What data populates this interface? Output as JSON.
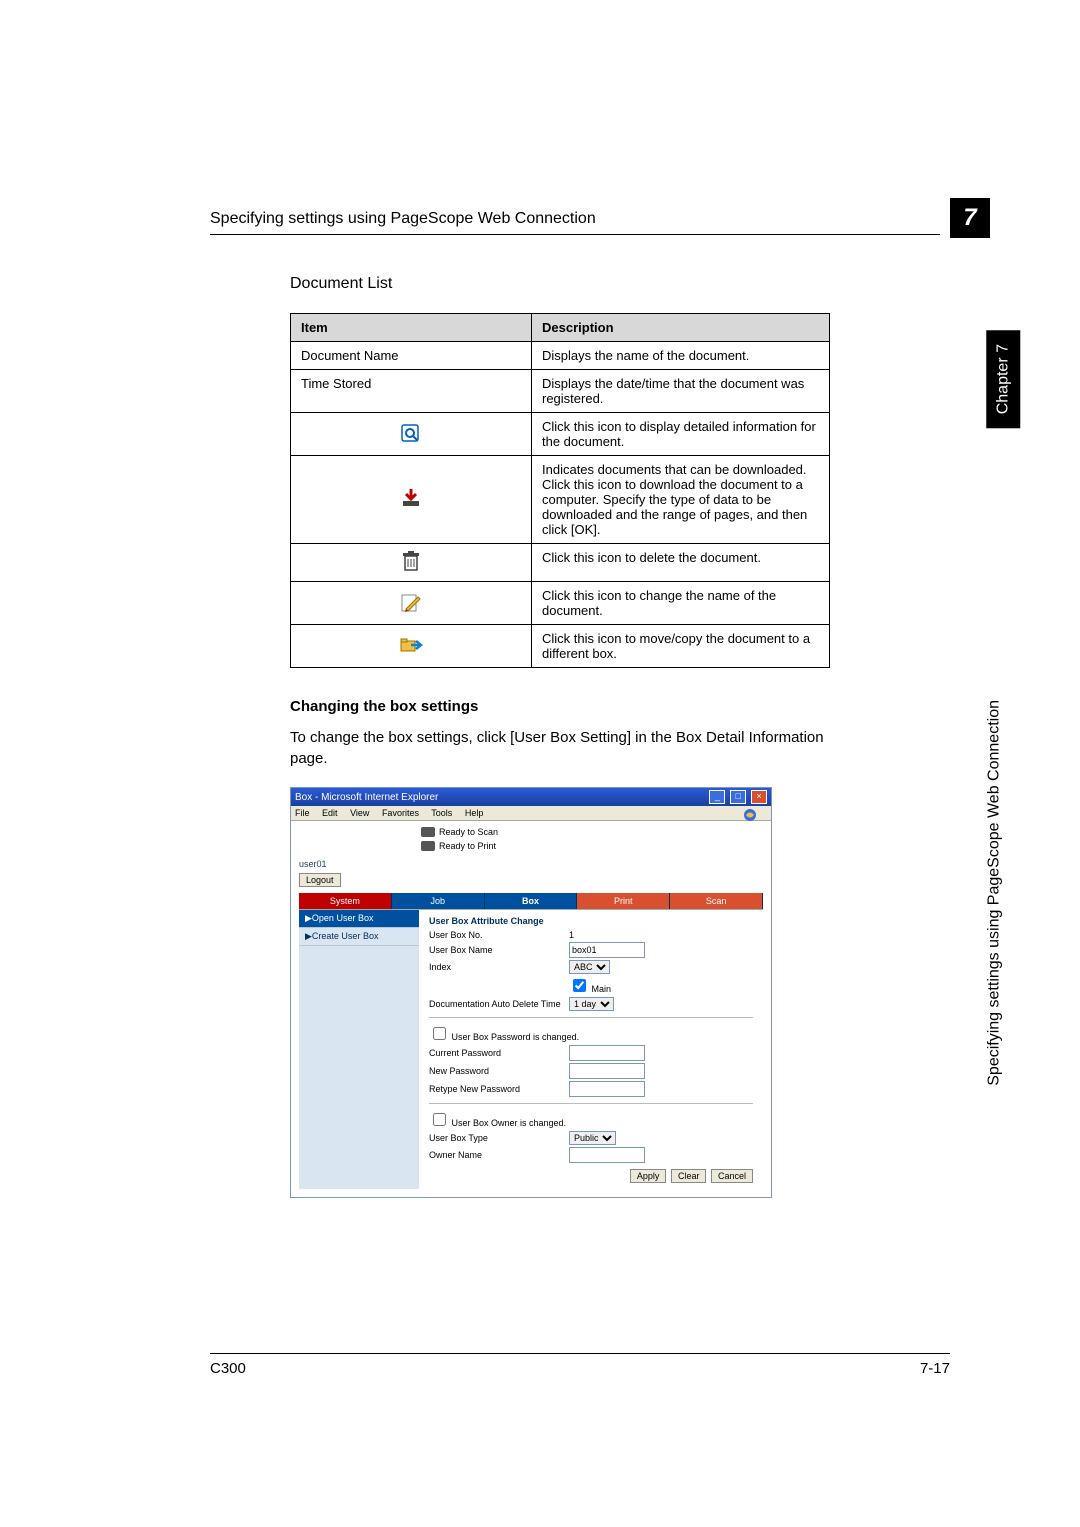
{
  "header": {
    "title": "Specifying settings using PageScope Web Connection"
  },
  "chapter": {
    "number": "7",
    "side_label": "Chapter 7",
    "side_text": "Specifying settings using PageScope Web Connection"
  },
  "section_title": "Document List",
  "table": {
    "headers": [
      "Item",
      "Description"
    ],
    "rows": [
      {
        "item_text": "Document Name",
        "desc": "Displays the name of the document."
      },
      {
        "item_text": "Time Stored",
        "desc": "Displays the date/time that the document was registered."
      },
      {
        "item_icon": "view-icon",
        "desc": "Click this icon to display detailed information for the document."
      },
      {
        "item_icon": "download-icon",
        "desc": "Indicates documents that can be downloaded. Click this icon to download the document to a computer. Specify the type of data to be downloaded and the range of pages, and then click [OK]."
      },
      {
        "item_icon": "delete-icon",
        "desc": "Click this icon to delete the document."
      },
      {
        "item_icon": "rename-icon",
        "desc": "Click this icon to change the name of the document."
      },
      {
        "item_icon": "move-icon",
        "desc": "Click this icon to move/copy the document to a different box."
      }
    ]
  },
  "subheading": "Changing the box settings",
  "body_text": "To change the box settings, click [User Box Setting] in the Box Detail Information page.",
  "browser": {
    "title": "Box - Microsoft Internet Explorer",
    "menu": [
      "File",
      "Edit",
      "View",
      "Favorites",
      "Tools",
      "Help"
    ],
    "status": {
      "scan": "Ready to Scan",
      "print": "Ready to Print"
    },
    "user": "user01",
    "logout": "Logout",
    "tabs": {
      "system": "System",
      "job": "Job",
      "box": "Box",
      "print": "Print",
      "scan": "Scan"
    },
    "sidebar": {
      "open": "▶Open User Box",
      "create": "▶Create User Box"
    },
    "form": {
      "heading": "User Box Attribute Change",
      "boxno_lbl": "User Box No.",
      "boxno_val": "1",
      "boxname_lbl": "User Box Name",
      "boxname_val": "box01",
      "index_lbl": "Index",
      "index_val": "ABC",
      "main_chk": "Main",
      "autodel_lbl": "Documentation Auto Delete Time",
      "autodel_val": "1 day",
      "pwchg_chk": "User Box Password is changed.",
      "curpw_lbl": "Current Password",
      "newpw_lbl": "New Password",
      "repw_lbl": "Retype New Password",
      "ownchg_chk": "User Box Owner is changed.",
      "boxtype_lbl": "User Box Type",
      "boxtype_val": "Public",
      "owner_lbl": "Owner Name",
      "apply": "Apply",
      "clear": "Clear",
      "cancel": "Cancel"
    }
  },
  "footer": {
    "left": "C300",
    "right": "7-17"
  }
}
